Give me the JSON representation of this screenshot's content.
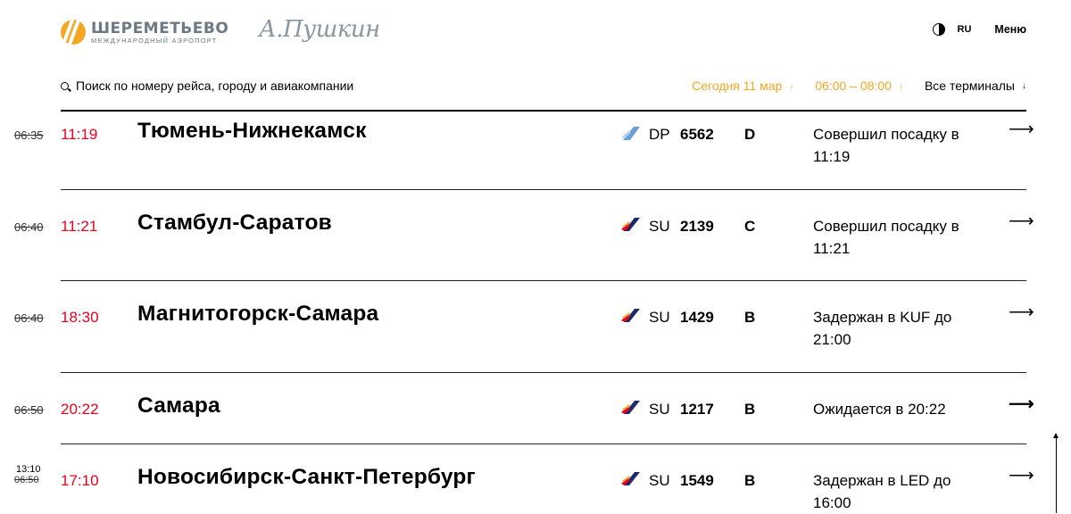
{
  "header": {
    "logo_title": "ШЕРЕМЕТЬЕВО",
    "logo_subtitle": "МЕЖДУНАРОДНЫЙ АЭРОПОРТ",
    "signature": "А.Пушкин",
    "lang": "RU",
    "menu": "Меню"
  },
  "search": {
    "placeholder": "Поиск по номеру рейса, городу и авиакомпании"
  },
  "filters": {
    "date": "Сегодня 11 мар",
    "time": "06:00 – 08:00",
    "terminals": "Все терминалы",
    "arrow": "↓"
  },
  "colors": {
    "accent": "#F5A623",
    "delay": "#e8001c"
  },
  "flights": [
    {
      "scheduled": "06:35",
      "actual": "11:19",
      "route": "Тюмень-Нижнекамск",
      "airline_icon": "dp-airline-icon",
      "airline": "DP",
      "number": "6562",
      "terminal": "D",
      "status": "Совершил посадку в 11:19",
      "arrow": "⟶"
    },
    {
      "scheduled": "06:40",
      "actual": "11:21",
      "route": "Стамбул-Саратов",
      "airline_icon": "su-airline-icon",
      "airline": "SU",
      "number": "2139",
      "terminal": "C",
      "status": "Совершил посадку в 11:21",
      "arrow": "⟶"
    },
    {
      "scheduled": "06:40",
      "actual": "18:30",
      "route": "Магнитогорск-Самара",
      "airline_icon": "su-airline-icon",
      "airline": "SU",
      "number": "1429",
      "terminal": "B",
      "status": "Задержан в KUF до 21:00",
      "arrow": "⟶"
    },
    {
      "scheduled": "06:50",
      "actual": "20:22",
      "route": "Самара",
      "airline_icon": "su-airline-icon",
      "airline": "SU",
      "number": "1217",
      "terminal": "B",
      "status": "Ожидается в 20:22",
      "arrow": "⟶"
    },
    {
      "scheduled": "06:50",
      "extra_time": "13:10",
      "actual": "17:10",
      "route": "Новосибирск-Санкт-Петербург",
      "airline_icon": "su-airline-icon",
      "airline": "SU",
      "number": "1549",
      "terminal": "B",
      "status": "Задержан в LED до 16:00",
      "arrow": "⟶"
    }
  ]
}
